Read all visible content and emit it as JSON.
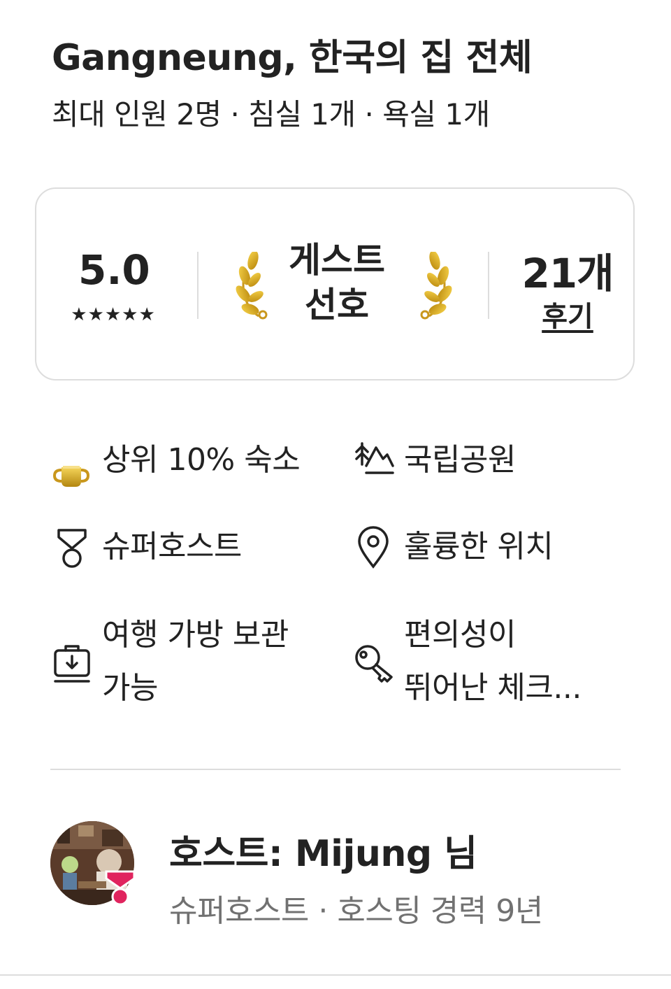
{
  "listing": {
    "title": "Gangneung, 한국의 집 전체",
    "subtitle": "최대 인원 2명 · 침실 1개 · 욕실 1개"
  },
  "summary_card": {
    "rating": "5.0",
    "stars": "★★★★★",
    "guest_favorite_line1": "게스트",
    "guest_favorite_line2": "선호",
    "review_count": "21개",
    "reviews_label": "후기"
  },
  "highlights": [
    {
      "icon": "trophy-icon",
      "label": "상위 10% 숙소"
    },
    {
      "icon": "mountain-icon",
      "label": "국립공원"
    },
    {
      "icon": "superhost-medal-icon",
      "label": "슈퍼호스트"
    },
    {
      "icon": "location-pin-icon",
      "label": "훌륭한 위치"
    },
    {
      "icon": "luggage-storage-icon",
      "label_line1": "여행 가방 보관",
      "label_line2": "가능"
    },
    {
      "icon": "key-icon",
      "label_line1": "편의성이",
      "label_line2": "뛰어난 체크..."
    }
  ],
  "host": {
    "name": "호스트: Mijung 님",
    "meta": "슈퍼호스트 · 호스팅 경력 9년"
  },
  "colors": {
    "text": "#222222",
    "muted": "#717171",
    "divider": "#dddddd",
    "superhost_badge": "#e0245e",
    "gold": "#d4a520"
  }
}
